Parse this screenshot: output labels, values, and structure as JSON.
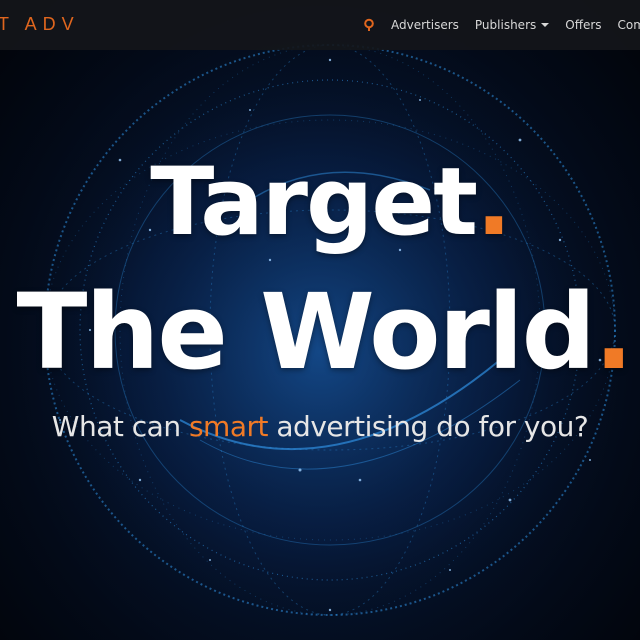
{
  "header": {
    "logo_text": "T ADV",
    "nav": {
      "search_icon": "search-icon",
      "items": [
        {
          "label": "Advertisers",
          "has_caret": false
        },
        {
          "label": "Publishers",
          "has_caret": true
        },
        {
          "label": "Offers",
          "has_caret": false
        },
        {
          "label": "Compan",
          "has_caret": false
        }
      ]
    }
  },
  "hero": {
    "headline_line1": "Target",
    "headline_line2": "The World",
    "headline_dot": ".",
    "tagline_before": "What can ",
    "tagline_accent": "smart",
    "tagline_after": " advertising do for you?"
  },
  "colors": {
    "accent": "#f07a26",
    "nav_bg": "#14161a",
    "background": "#030a18",
    "globe_lines": "#2f8fe0"
  }
}
